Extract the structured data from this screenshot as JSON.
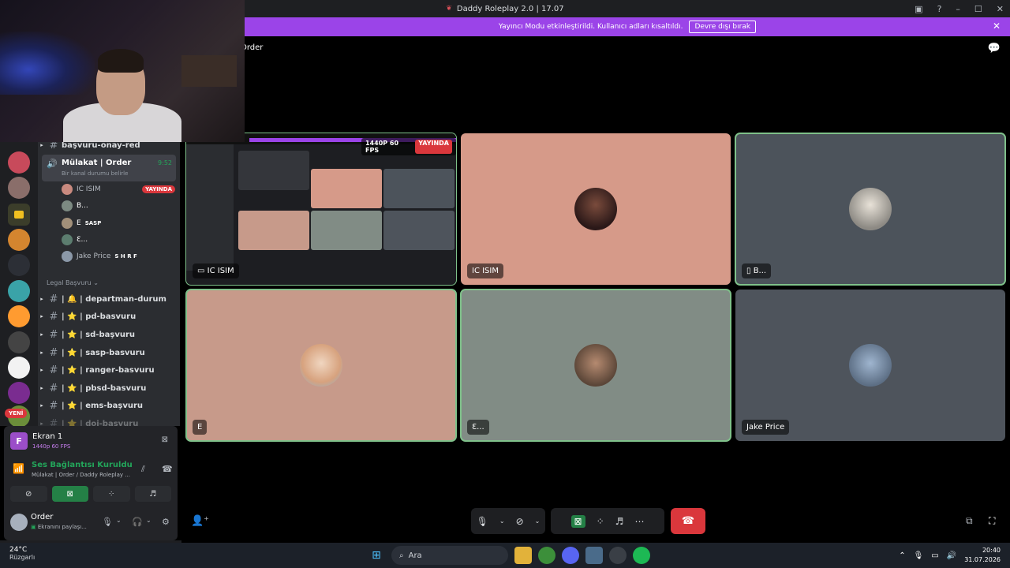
{
  "window": {
    "title": "Daddy Roleplay 2.0 | 17.07"
  },
  "banner": {
    "text": "Yayıncı Modu etkinleştirildi. Kullanıcı adları kısaltıldı.",
    "button": "Devre dışı bırak"
  },
  "call": {
    "channel_label": "Order"
  },
  "sidebar": {
    "top_channel": "başvuru-onay-red",
    "voice_channel": {
      "name": "Mülakat | Order",
      "time": "9:52",
      "status_placeholder": "Bir kanal durumu belirle"
    },
    "members": [
      {
        "name": "IC ISIM",
        "badge": "YAYINDA",
        "color": "#c98a7f"
      },
      {
        "name": "B...",
        "badge": "",
        "color": "#7c8a82"
      },
      {
        "name": "E",
        "badge": "SASP",
        "color": "#a2907a"
      },
      {
        "name": "Ɛ...",
        "badge": "",
        "color": "#5c7d6f"
      },
      {
        "name": "Jake Price",
        "badge": "S H R F",
        "color": "#8b98a8"
      }
    ],
    "category": "Legal Başvuru",
    "channels": [
      "| 🔔 | departman-durum",
      "| ⭐ | pd-basvuru",
      "| ⭐ | sd-başvuru",
      "| ⭐ | sasp-basvuru",
      "| ⭐ | ranger-basvuru",
      "| ⭐ | pbsd-basvuru",
      "| ⭐ | ems-başvuru",
      "| ⭐ | doj-basvuru"
    ],
    "new_badge": "YENİ"
  },
  "stream_panel": {
    "icon_letter": "F",
    "title": "Ekran 1",
    "quality": "1440p 60 FPS"
  },
  "voice_panel": {
    "status": "Ses Bağlantısı Kuruldu",
    "location": "Mülakat | Order / Daddy Roleplay ..."
  },
  "user_panel": {
    "name": "Order",
    "status": "Ekranını paylaşı..."
  },
  "tiles": [
    {
      "label": "IC ISIM",
      "bg": "#1d1e22"
    },
    {
      "label": "IC ISIM",
      "bg": "#d69a89"
    },
    {
      "label": "B...",
      "bg": "#4c535b"
    },
    {
      "label": "E",
      "bg": "#c79a8a"
    },
    {
      "label": "Ɛ...",
      "bg": "#818c85"
    },
    {
      "label": "Jake Price",
      "bg": "#4e545c"
    }
  ],
  "stream_tile": {
    "quality": "1440P 60 FPS",
    "live": "YAYINDA"
  },
  "taskbar": {
    "temperature": "24°C",
    "weather": "Rüzgarlı",
    "search": "Ara",
    "time": "20:40",
    "date": "31.07.2026"
  }
}
